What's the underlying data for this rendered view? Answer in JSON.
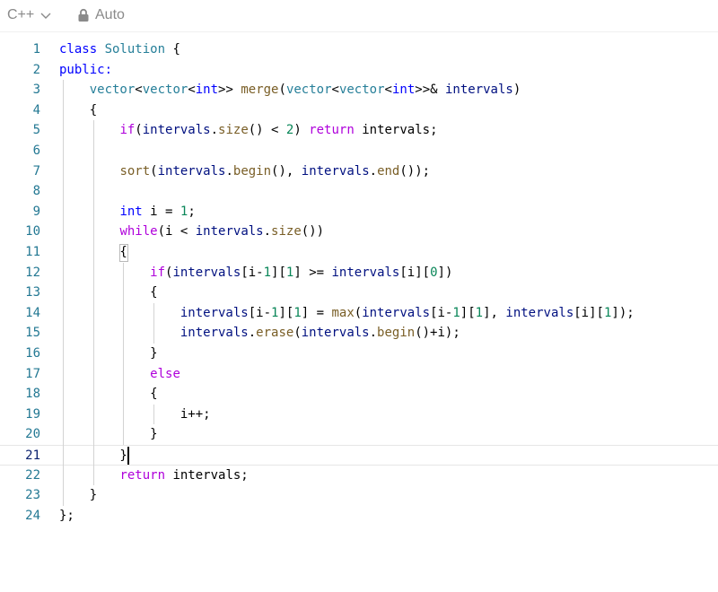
{
  "toolbar": {
    "language": "C++",
    "mode": "Auto",
    "icons": {
      "dropdown": "chevron-down-icon",
      "lock": "lock-icon"
    }
  },
  "colors": {
    "keyword": "#0000ff",
    "control": "#af00db",
    "type": "#267f99",
    "function": "#795e26",
    "variable": "#001080",
    "number": "#098658",
    "plain": "#000000",
    "line_number": "#237893",
    "line_number_active": "#0b216f"
  },
  "editor": {
    "active_line": 21,
    "lines": [
      {
        "n": "1",
        "tokens": [
          [
            "class ",
            "keyword"
          ],
          [
            "Solution",
            "type"
          ],
          [
            " {",
            "plain"
          ]
        ]
      },
      {
        "n": "2",
        "tokens": [
          [
            "public:",
            "keyword"
          ]
        ]
      },
      {
        "n": "3",
        "tokens": [
          [
            "    ",
            "plain"
          ],
          [
            "vector",
            "type"
          ],
          [
            "<",
            "plain"
          ],
          [
            "vector",
            "type"
          ],
          [
            "<",
            "plain"
          ],
          [
            "int",
            "keyword"
          ],
          [
            ">> ",
            "plain"
          ],
          [
            "merge",
            "function"
          ],
          [
            "(",
            "plain"
          ],
          [
            "vector",
            "type"
          ],
          [
            "<",
            "plain"
          ],
          [
            "vector",
            "type"
          ],
          [
            "<",
            "plain"
          ],
          [
            "int",
            "keyword"
          ],
          [
            ">>& ",
            "plain"
          ],
          [
            "intervals",
            "variable"
          ],
          [
            ")",
            "plain"
          ]
        ]
      },
      {
        "n": "4",
        "tokens": [
          [
            "    {",
            "plain"
          ]
        ]
      },
      {
        "n": "5",
        "tokens": [
          [
            "        ",
            "plain"
          ],
          [
            "if",
            "control"
          ],
          [
            "(",
            "plain"
          ],
          [
            "intervals",
            "variable"
          ],
          [
            ".",
            "plain"
          ],
          [
            "size",
            "function"
          ],
          [
            "() < ",
            "plain"
          ],
          [
            "2",
            "number"
          ],
          [
            ") ",
            "plain"
          ],
          [
            "return",
            "control"
          ],
          [
            " intervals;",
            "plain"
          ]
        ]
      },
      {
        "n": "6",
        "tokens": []
      },
      {
        "n": "7",
        "tokens": [
          [
            "        ",
            "plain"
          ],
          [
            "sort",
            "function"
          ],
          [
            "(",
            "plain"
          ],
          [
            "intervals",
            "variable"
          ],
          [
            ".",
            "plain"
          ],
          [
            "begin",
            "function"
          ],
          [
            "(), ",
            "plain"
          ],
          [
            "intervals",
            "variable"
          ],
          [
            ".",
            "plain"
          ],
          [
            "end",
            "function"
          ],
          [
            "());",
            "plain"
          ]
        ]
      },
      {
        "n": "8",
        "tokens": []
      },
      {
        "n": "9",
        "tokens": [
          [
            "        ",
            "plain"
          ],
          [
            "int",
            "keyword"
          ],
          [
            " i = ",
            "plain"
          ],
          [
            "1",
            "number"
          ],
          [
            ";",
            "plain"
          ]
        ]
      },
      {
        "n": "10",
        "tokens": [
          [
            "        ",
            "plain"
          ],
          [
            "while",
            "control"
          ],
          [
            "(i < ",
            "plain"
          ],
          [
            "intervals",
            "variable"
          ],
          [
            ".",
            "plain"
          ],
          [
            "size",
            "function"
          ],
          [
            "())",
            "plain"
          ]
        ]
      },
      {
        "n": "11",
        "tokens": [
          [
            "        {",
            "plain"
          ]
        ]
      },
      {
        "n": "12",
        "tokens": [
          [
            "            ",
            "plain"
          ],
          [
            "if",
            "control"
          ],
          [
            "(",
            "plain"
          ],
          [
            "intervals",
            "variable"
          ],
          [
            "[i-",
            "plain"
          ],
          [
            "1",
            "number"
          ],
          [
            "][",
            "plain"
          ],
          [
            "1",
            "number"
          ],
          [
            "] >= ",
            "plain"
          ],
          [
            "intervals",
            "variable"
          ],
          [
            "[i][",
            "plain"
          ],
          [
            "0",
            "number"
          ],
          [
            "])",
            "plain"
          ]
        ]
      },
      {
        "n": "13",
        "tokens": [
          [
            "            {",
            "plain"
          ]
        ]
      },
      {
        "n": "14",
        "tokens": [
          [
            "                ",
            "plain"
          ],
          [
            "intervals",
            "variable"
          ],
          [
            "[i-",
            "plain"
          ],
          [
            "1",
            "number"
          ],
          [
            "][",
            "plain"
          ],
          [
            "1",
            "number"
          ],
          [
            "] = ",
            "plain"
          ],
          [
            "max",
            "function"
          ],
          [
            "(",
            "plain"
          ],
          [
            "intervals",
            "variable"
          ],
          [
            "[i-",
            "plain"
          ],
          [
            "1",
            "number"
          ],
          [
            "][",
            "plain"
          ],
          [
            "1",
            "number"
          ],
          [
            "], ",
            "plain"
          ],
          [
            "intervals",
            "variable"
          ],
          [
            "[i][",
            "plain"
          ],
          [
            "1",
            "number"
          ],
          [
            "]);",
            "plain"
          ]
        ]
      },
      {
        "n": "15",
        "tokens": [
          [
            "                ",
            "plain"
          ],
          [
            "intervals",
            "variable"
          ],
          [
            ".",
            "plain"
          ],
          [
            "erase",
            "function"
          ],
          [
            "(",
            "plain"
          ],
          [
            "intervals",
            "variable"
          ],
          [
            ".",
            "plain"
          ],
          [
            "begin",
            "function"
          ],
          [
            "()+i);",
            "plain"
          ]
        ]
      },
      {
        "n": "16",
        "tokens": [
          [
            "            }",
            "plain"
          ]
        ]
      },
      {
        "n": "17",
        "tokens": [
          [
            "            ",
            "plain"
          ],
          [
            "else",
            "control"
          ]
        ]
      },
      {
        "n": "18",
        "tokens": [
          [
            "            {",
            "plain"
          ]
        ]
      },
      {
        "n": "19",
        "tokens": [
          [
            "                i++;",
            "plain"
          ]
        ]
      },
      {
        "n": "20",
        "tokens": [
          [
            "            }",
            "plain"
          ]
        ]
      },
      {
        "n": "21",
        "tokens": [
          [
            "        }",
            "plain"
          ]
        ]
      },
      {
        "n": "22",
        "tokens": [
          [
            "        ",
            "plain"
          ],
          [
            "return",
            "control"
          ],
          [
            " intervals;",
            "plain"
          ]
        ]
      },
      {
        "n": "23",
        "tokens": [
          [
            "    }",
            "plain"
          ]
        ]
      },
      {
        "n": "24",
        "tokens": [
          [
            "};",
            "plain"
          ]
        ]
      }
    ]
  }
}
